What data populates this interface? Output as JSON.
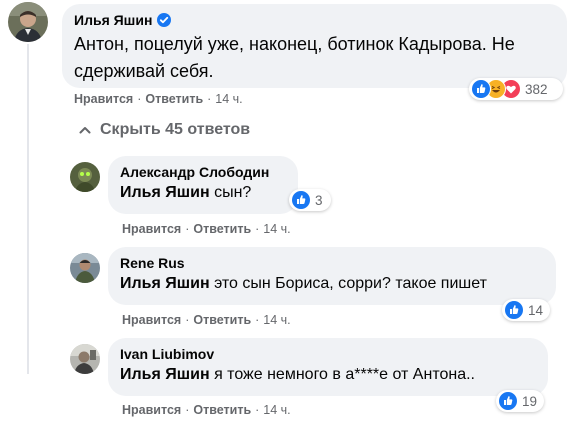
{
  "main_comment": {
    "author": "Илья Яшин",
    "text": "Антон, поцелуй уже, наконец, ботинок Кадырова. Не сдерживай себя.",
    "like_label": "Нравится",
    "reply_label": "Ответить",
    "time": "14 ч.",
    "reaction_count": "382",
    "reactions": [
      "like-icon",
      "haha-icon",
      "love-icon"
    ],
    "verified_icon": "verified-badge-icon"
  },
  "hide_replies": {
    "label": "Скрыть 45 ответов",
    "icon": "chevron-up-icon"
  },
  "replies": [
    {
      "author": "Александр Слободин",
      "mention": "Илья Яшин",
      "text": " сын?",
      "like_label": "Нравится",
      "reply_label": "Ответить",
      "time": "14 ч.",
      "reaction_count": "3"
    },
    {
      "author": "Rene Rus",
      "mention": "Илья Яшин",
      "text": " это сын Бориса, сорри? такое пишет",
      "like_label": "Нравится",
      "reply_label": "Ответить",
      "time": "14 ч.",
      "reaction_count": "14"
    },
    {
      "author": "Ivan Liubimov",
      "mention": "Илья Яшин",
      "text": " я тоже немного в а****е от Антона..",
      "like_label": "Нравится",
      "reply_label": "Ответить",
      "time": "14 ч.",
      "reaction_count": "19"
    }
  ],
  "colors": {
    "bubble": "#f0f2f5",
    "secondary_text": "#65676b",
    "like_blue": "#1877f2",
    "love_red": "#f33e58",
    "haha_yellow": "#f7b125"
  }
}
